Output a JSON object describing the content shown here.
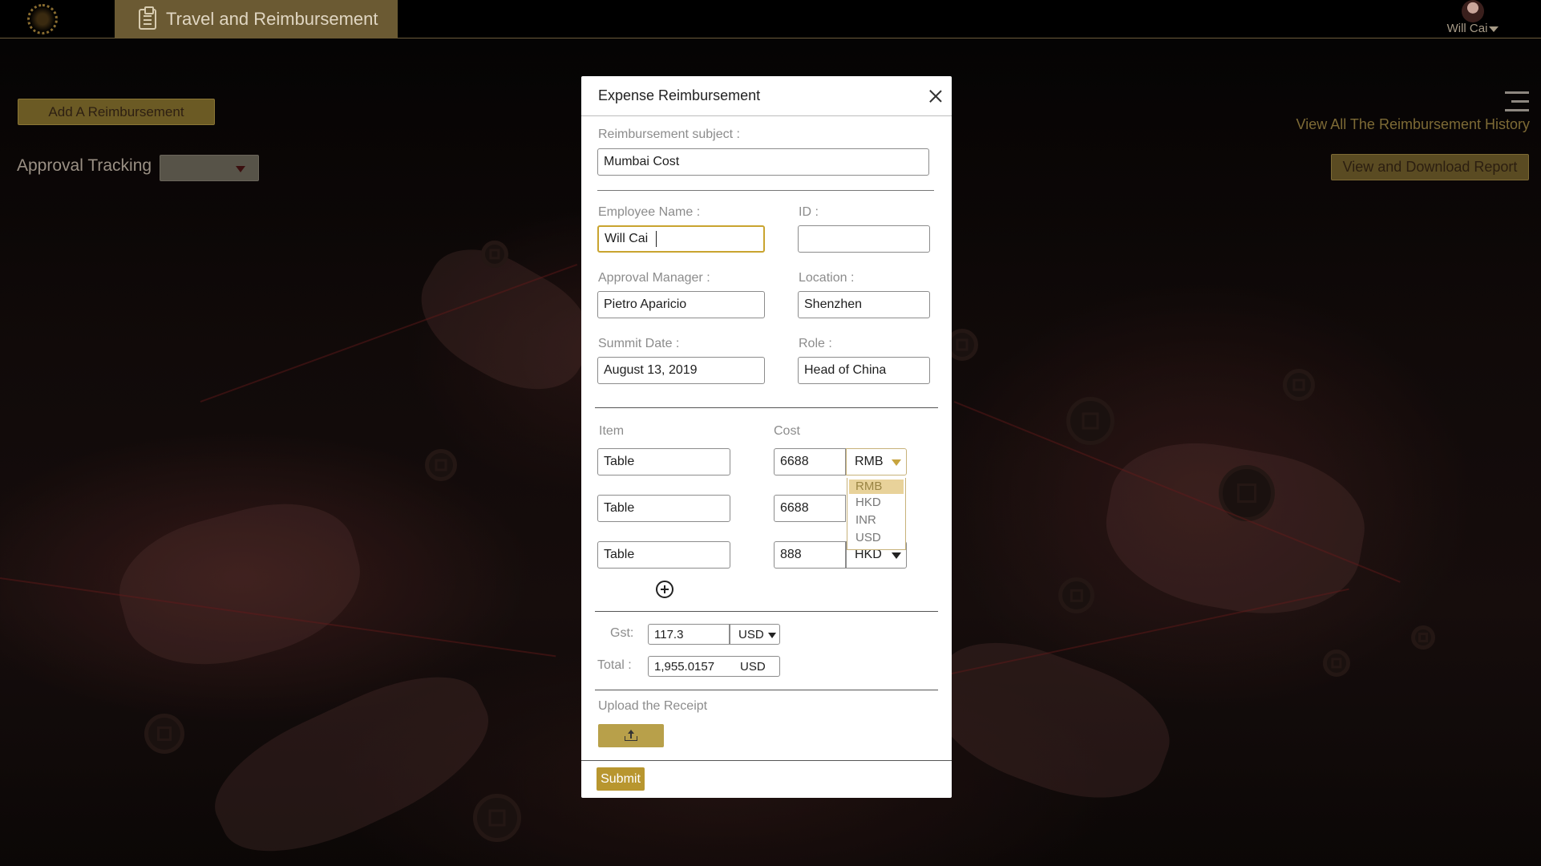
{
  "header": {
    "app_title": "Travel and Reimbursement",
    "user_name": "Will Cai"
  },
  "left": {
    "add_button": "Add A Reimbursement",
    "approval_label": "Approval Tracking",
    "approval_value": ""
  },
  "right": {
    "history_link": "View All The Reimbursement History",
    "report_button": "View and Download Report"
  },
  "modal": {
    "title": "Expense Reimbursement",
    "subject_label": "Reimbursement subject :",
    "subject_value": "Mumbai Cost",
    "employee_label": "Employee Name :",
    "employee_value": "Will Cai",
    "id_label": "ID :",
    "id_value": "",
    "manager_label": "Approval Manager :",
    "manager_value": "Pietro Aparicio",
    "location_label": "Location :",
    "location_value": "Shenzhen",
    "date_label": "Summit Date :",
    "date_value": "August 13, 2019",
    "role_label": "Role :",
    "role_value": "Head of China",
    "item_header": "Item",
    "cost_header": "Cost",
    "rows": [
      {
        "item": "Table",
        "cost": "6688",
        "currency": "RMB"
      },
      {
        "item": "Table",
        "cost": "6688",
        "currency": ""
      },
      {
        "item": "Table",
        "cost": "888",
        "currency": "HKD"
      }
    ],
    "currency_options": [
      "RMB",
      "HKD",
      "INR",
      "USD"
    ],
    "gst_label": "Gst:",
    "gst_value": "117.3",
    "gst_currency": "USD",
    "total_label": "Total :",
    "total_value": "1,955.0157",
    "total_currency": "USD",
    "upload_label": "Upload the Receipt",
    "submit": "Submit"
  },
  "colors": {
    "accent_gold": "#b8962f",
    "topbar": "#000000",
    "tab_bg": "#6b5a33"
  },
  "icons": [
    "logo-icon",
    "clipboard-icon",
    "chevron-down-icon",
    "menu-icon",
    "close-icon",
    "add-circle-icon",
    "upload-icon"
  ]
}
